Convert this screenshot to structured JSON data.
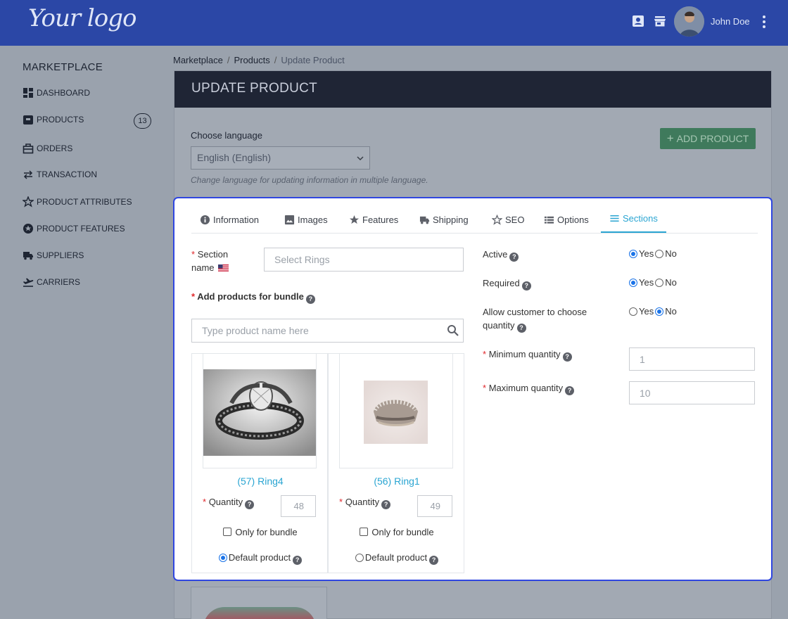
{
  "header": {
    "logo_text": "Your logo",
    "user_name": "John Doe"
  },
  "sidebar": {
    "title": "MARKETPLACE",
    "items": [
      {
        "label": "DASHBOARD",
        "icon": "dashboard-icon"
      },
      {
        "label": "PRODUCTS",
        "icon": "products-icon",
        "badge": "13"
      },
      {
        "label": "ORDERS",
        "icon": "orders-icon"
      },
      {
        "label": "TRANSACTION",
        "icon": "transaction-icon"
      },
      {
        "label": "PRODUCT ATTRIBUTES",
        "icon": "star-icon"
      },
      {
        "label": "PRODUCT FEATURES",
        "icon": "features-icon"
      },
      {
        "label": "SUPPLIERS",
        "icon": "truck-icon"
      },
      {
        "label": "CARRIERS",
        "icon": "plane-icon"
      }
    ]
  },
  "breadcrumb": [
    "Marketplace",
    "Products",
    "Update Product"
  ],
  "page": {
    "title": "UPDATE PRODUCT",
    "add_button": "ADD PRODUCT",
    "language_label": "Choose language",
    "language_value": "English (English)",
    "language_help": "Change language for updating information in multiple language."
  },
  "tabs": [
    {
      "label": "Information",
      "icon": "info-icon"
    },
    {
      "label": "Images",
      "icon": "image-icon"
    },
    {
      "label": "Features",
      "icon": "star-icon"
    },
    {
      "label": "Shipping",
      "icon": "truck-icon"
    },
    {
      "label": "SEO",
      "icon": "star-outline-icon"
    },
    {
      "label": "Options",
      "icon": "list-icon"
    },
    {
      "label": "Sections",
      "icon": "menu-icon",
      "active": true
    }
  ],
  "form": {
    "section_name_label_1": "Section",
    "section_name_label_2": "name",
    "section_name_placeholder": "Select Rings",
    "add_products_label": "Add products for bundle",
    "search_placeholder": "Type product name here",
    "required_mark": "*",
    "help_mark": "?"
  },
  "products": [
    {
      "name": "(57) Ring4",
      "quantity_label": "Quantity",
      "quantity": "48",
      "only_bundle_label": "Only for bundle",
      "only_bundle": false,
      "default_label": "Default product",
      "default": true
    },
    {
      "name": "(56) Ring1",
      "quantity_label": "Quantity",
      "quantity": "49",
      "only_bundle_label": "Only for bundle",
      "only_bundle": false,
      "default_label": "Default product",
      "default": false
    }
  ],
  "settings": {
    "active_label": "Active",
    "active": "Yes",
    "required_label": "Required",
    "required": "Yes",
    "allow_label_1": "Allow customer to choose",
    "allow_label_2": "quantity",
    "allow": "No",
    "yes_label": "Yes",
    "no_label": "No",
    "min_label": "Minimum quantity",
    "min_value": "1",
    "max_label": "Maximum quantity",
    "max_value": "10"
  },
  "colors": {
    "header": "#2b47a6",
    "accent": "#2aa5d2",
    "focus_border": "#2f46e0",
    "add_button": "#3f7a5c"
  }
}
